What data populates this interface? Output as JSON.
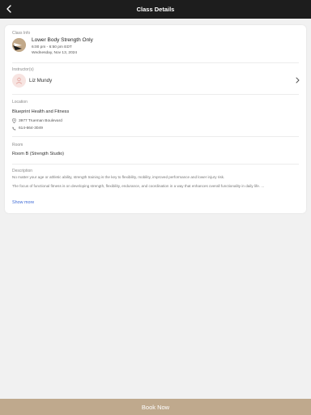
{
  "header": {
    "title": "Class Details"
  },
  "class_info": {
    "label": "Class Info",
    "name": "Lower Body Strength Only",
    "time": "6:00 pm - 6:50 pm EDT",
    "date": "Wednesday, Nov 13, 2024"
  },
  "instructors": {
    "label": "Instructor(s)",
    "name": "Liz Mundy"
  },
  "location": {
    "label": "Location",
    "name": "Blueprint Health and Fitness",
    "address": "3977 Trueman Boulevard",
    "phone": "614-664-3049"
  },
  "room": {
    "label": "Room",
    "name": "Room B (Strength Studio)"
  },
  "description": {
    "label": "Description",
    "paragraph1": "No matter your age or athletic ability, strength training is the key to flexibility, mobility, improved performance and lower injury risk.",
    "paragraph2": "The focus of functional fitness is on developing strength, flexibility, endurance, and coordination in a way that enhances overall functionality in daily life. ...",
    "show_more": "Show more"
  },
  "footer": {
    "book_label": "Book Now"
  },
  "colors": {
    "topbar": "#1d1d1d",
    "accent": "#bfa98d",
    "link": "#3f6bd6"
  }
}
